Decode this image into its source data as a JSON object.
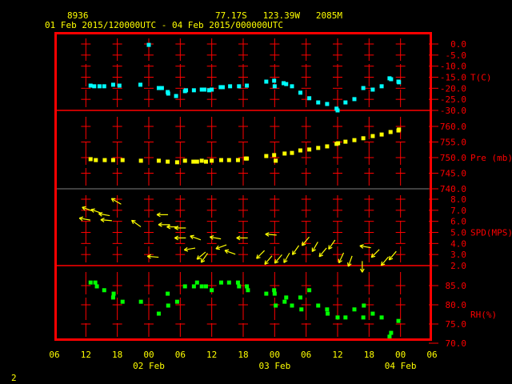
{
  "header": {
    "station_id": "8936",
    "location": "77.17S   123.39W   2085M",
    "period": "01 Feb 2015/120000UTC - 04 Feb 2015/000000UTC"
  },
  "footer": {
    "page_number": "2"
  },
  "colors": {
    "frame": "#ff0000",
    "text": "#ffff00",
    "axis_text": "#ff0000",
    "temp": "#00ffff",
    "pressure": "#ffff00",
    "wind": "#ffff00",
    "rh": "#00ff00"
  },
  "chart_data": {
    "type": "scatter",
    "title": "8936  77.17S 123.39W 2085M",
    "subtitle": "01 Feb 2015/120000UTC - 04 Feb 2015/000000UTC",
    "x_unit": "hours since 01 Feb 06 UTC",
    "xlim": [
      0,
      72
    ],
    "x_ticks": [
      "06",
      "12",
      "18",
      "00",
      "06",
      "12",
      "18",
      "00",
      "06",
      "12",
      "18",
      "00",
      "06"
    ],
    "date_labels": [
      {
        "label": "02 Feb",
        "hour": 18
      },
      {
        "label": "03 Feb",
        "hour": 42
      },
      {
        "label": "04 Feb",
        "hour": 66
      }
    ],
    "panels": [
      {
        "name": "temperature",
        "label": "T(C)",
        "ylim": [
          -30,
          0
        ],
        "ticks": [
          "0.0",
          "-5.0",
          "-10.0",
          "-15.0",
          "-20.0",
          "-25.0",
          "-30.0"
        ],
        "tick_values": [
          0,
          -5,
          -10,
          -15,
          -20,
          -25,
          -30
        ],
        "points": [
          [
            6.9,
            -18.8
          ],
          [
            7.6,
            -19.1
          ],
          [
            8.6,
            -19.1
          ],
          [
            9.5,
            -19.1
          ],
          [
            11.2,
            -18.4
          ],
          [
            12.4,
            -18.8
          ],
          [
            16.4,
            -18.4
          ],
          [
            18.0,
            -0.4
          ],
          [
            19.9,
            -19.9
          ],
          [
            20.5,
            -19.9
          ],
          [
            21.6,
            -21.7
          ],
          [
            21.7,
            -22.4
          ],
          [
            23.2,
            -23.5
          ],
          [
            24.9,
            -21.3
          ],
          [
            25.1,
            -20.9
          ],
          [
            26.6,
            -20.9
          ],
          [
            28.1,
            -20.6
          ],
          [
            28.6,
            -20.6
          ],
          [
            29.5,
            -20.9
          ],
          [
            30.0,
            -20.6
          ],
          [
            31.7,
            -19.5
          ],
          [
            32.1,
            -19.5
          ],
          [
            33.5,
            -19.1
          ],
          [
            35.2,
            -19.1
          ],
          [
            36.7,
            -18.8
          ],
          [
            40.4,
            -17.0
          ],
          [
            41.9,
            -16.6
          ],
          [
            42.0,
            -19.1
          ],
          [
            43.7,
            -17.7
          ],
          [
            44.2,
            -18.1
          ],
          [
            45.3,
            -19.1
          ],
          [
            46.9,
            -22.0
          ],
          [
            48.6,
            -24.5
          ],
          [
            50.3,
            -26.4
          ],
          [
            52.0,
            -27.1
          ],
          [
            53.8,
            -29.2
          ],
          [
            54.0,
            -30.0
          ],
          [
            55.5,
            -26.4
          ],
          [
            57.2,
            -24.9
          ],
          [
            58.9,
            -19.9
          ],
          [
            60.7,
            -20.6
          ],
          [
            62.4,
            -19.1
          ],
          [
            63.9,
            -15.5
          ],
          [
            64.2,
            -15.9
          ],
          [
            65.6,
            -17.0
          ],
          [
            65.7,
            -17.3
          ]
        ]
      },
      {
        "name": "pressure",
        "label": "Pre (mb)",
        "ylim": [
          740,
          764
        ],
        "ticks": [
          "760.0",
          "755.0",
          "750.0",
          "745.0",
          "740.0"
        ],
        "tick_values": [
          760,
          755,
          750,
          745,
          740
        ],
        "points": [
          [
            6.9,
            749.5
          ],
          [
            7.9,
            749.2
          ],
          [
            9.6,
            749.2
          ],
          [
            11.2,
            749.2
          ],
          [
            13.0,
            749.2
          ],
          [
            16.5,
            749.0
          ],
          [
            19.9,
            749.0
          ],
          [
            21.6,
            748.7
          ],
          [
            23.4,
            748.5
          ],
          [
            24.9,
            749.0
          ],
          [
            26.5,
            748.7
          ],
          [
            27.2,
            748.7
          ],
          [
            28.1,
            749.0
          ],
          [
            28.9,
            748.7
          ],
          [
            30.0,
            749.0
          ],
          [
            31.8,
            749.2
          ],
          [
            33.3,
            749.2
          ],
          [
            35.0,
            749.2
          ],
          [
            36.5,
            749.7
          ],
          [
            36.7,
            749.7
          ],
          [
            40.4,
            750.5
          ],
          [
            41.9,
            750.8
          ],
          [
            42.2,
            749.0
          ],
          [
            43.9,
            751.3
          ],
          [
            45.3,
            751.5
          ],
          [
            46.9,
            752.3
          ],
          [
            48.6,
            752.6
          ],
          [
            50.3,
            753.1
          ],
          [
            52.0,
            753.6
          ],
          [
            53.8,
            754.4
          ],
          [
            54.1,
            754.6
          ],
          [
            55.5,
            755.1
          ],
          [
            57.2,
            755.6
          ],
          [
            58.9,
            756.2
          ],
          [
            60.7,
            756.9
          ],
          [
            62.4,
            757.4
          ],
          [
            64.1,
            758.2
          ],
          [
            65.6,
            758.7
          ],
          [
            65.7,
            759.0
          ]
        ]
      },
      {
        "name": "wind_speed",
        "label": "SPD(MPS)",
        "ylim": [
          2,
          9
        ],
        "ticks": [
          "8.0",
          "7.0",
          "6.0",
          "5.0",
          "4.0",
          "3.0",
          "2.0"
        ],
        "tick_values": [
          8,
          7,
          6,
          5,
          4,
          3,
          2
        ],
        "direction_note": "direction wind comes from, degrees",
        "points": [
          [
            5.8,
            6.2,
            100
          ],
          [
            6.3,
            7.1,
            110
          ],
          [
            8.0,
            6.9,
            110
          ],
          [
            9.5,
            6.6,
            100
          ],
          [
            9.9,
            6.1,
            95
          ],
          [
            11.8,
            7.8,
            120
          ],
          [
            15.6,
            5.8,
            125
          ],
          [
            20.6,
            6.6,
            90
          ],
          [
            20.9,
            5.7,
            90
          ],
          [
            22.5,
            5.5,
            90
          ],
          [
            24.0,
            5.4,
            90
          ],
          [
            24.0,
            4.5,
            90
          ],
          [
            26.9,
            4.5,
            110
          ],
          [
            18.8,
            2.8,
            95
          ],
          [
            25.8,
            3.5,
            80
          ],
          [
            28.0,
            2.9,
            50
          ],
          [
            28.6,
            2.7,
            35
          ],
          [
            30.7,
            4.5,
            100
          ],
          [
            31.8,
            3.7,
            70
          ],
          [
            33.5,
            3.2,
            110
          ],
          [
            35.8,
            4.5,
            90
          ],
          [
            41.3,
            4.8,
            95
          ],
          [
            39.3,
            3.0,
            45
          ],
          [
            40.8,
            2.5,
            40
          ],
          [
            42.7,
            2.6,
            40
          ],
          [
            44.3,
            2.7,
            30
          ],
          [
            46.0,
            3.4,
            35
          ],
          [
            47.9,
            4.2,
            40
          ],
          [
            49.7,
            3.7,
            30
          ],
          [
            51.2,
            3.2,
            40
          ],
          [
            52.9,
            3.9,
            35
          ],
          [
            54.7,
            2.7,
            25
          ],
          [
            56.4,
            2.4,
            20
          ],
          [
            59.3,
            3.7,
            100
          ],
          [
            61.2,
            3.1,
            45
          ],
          [
            63.0,
            2.4,
            40
          ],
          [
            64.5,
            2.9,
            40
          ],
          [
            58.7,
            1.9,
            0
          ]
        ]
      },
      {
        "name": "relative_humidity",
        "label": "RH(%)",
        "ylim": [
          70,
          90
        ],
        "ticks": [
          "85.0",
          "80.0",
          "75.0",
          "70.0"
        ],
        "tick_values": [
          85,
          80,
          75,
          70
        ],
        "points": [
          [
            6.9,
            85.8
          ],
          [
            7.8,
            85.8
          ],
          [
            8.1,
            84.8
          ],
          [
            9.5,
            83.8
          ],
          [
            11.3,
            82.9
          ],
          [
            11.2,
            81.9
          ],
          [
            13.0,
            80.8
          ],
          [
            16.5,
            80.8
          ],
          [
            19.9,
            77.7
          ],
          [
            21.6,
            82.9
          ],
          [
            21.7,
            79.8
          ],
          [
            23.4,
            80.8
          ],
          [
            24.9,
            84.8
          ],
          [
            26.6,
            84.8
          ],
          [
            27.2,
            85.8
          ],
          [
            28.1,
            84.8
          ],
          [
            28.9,
            84.8
          ],
          [
            30.0,
            83.8
          ],
          [
            31.8,
            85.8
          ],
          [
            33.3,
            85.8
          ],
          [
            35.0,
            85.8
          ],
          [
            35.2,
            84.8
          ],
          [
            36.7,
            84.8
          ],
          [
            36.9,
            83.8
          ],
          [
            40.4,
            82.9
          ],
          [
            41.9,
            83.8
          ],
          [
            42.0,
            82.9
          ],
          [
            42.2,
            79.8
          ],
          [
            43.9,
            80.8
          ],
          [
            44.2,
            81.9
          ],
          [
            45.3,
            79.8
          ],
          [
            46.9,
            81.9
          ],
          [
            47.1,
            78.8
          ],
          [
            48.6,
            83.8
          ],
          [
            50.3,
            79.8
          ],
          [
            52.0,
            78.8
          ],
          [
            52.1,
            77.7
          ],
          [
            54.0,
            76.7
          ],
          [
            55.5,
            76.7
          ],
          [
            57.2,
            78.8
          ],
          [
            58.9,
            76.7
          ],
          [
            59.0,
            79.8
          ],
          [
            60.7,
            77.7
          ],
          [
            62.4,
            76.7
          ],
          [
            65.6,
            75.8
          ],
          [
            64.2,
            72.7
          ],
          [
            63.9,
            71.7
          ]
        ]
      }
    ]
  }
}
